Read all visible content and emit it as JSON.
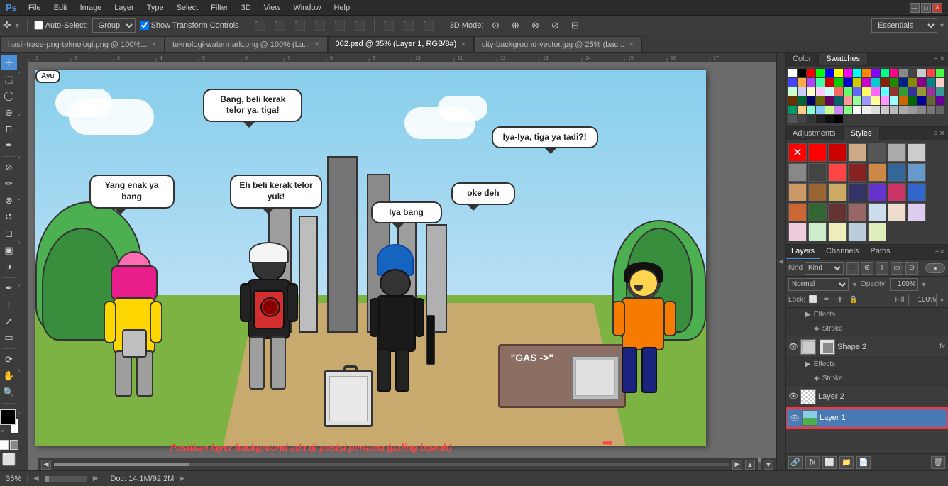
{
  "app": {
    "title": "Adobe Photoshop",
    "ps_icon": "Ps"
  },
  "menu": {
    "items": [
      "File",
      "Edit",
      "Image",
      "Layer",
      "Type",
      "Select",
      "Filter",
      "3D",
      "View",
      "Window",
      "Help"
    ]
  },
  "window_controls": {
    "minimize": "—",
    "maximize": "□",
    "close": "✕"
  },
  "options_bar": {
    "auto_select_label": "Auto-Select:",
    "group_value": "Group",
    "transform_label": "Show Transform Controls",
    "mode_label": "3D Mode:",
    "essentials_label": "Essentials",
    "essentials_arrow": "▼"
  },
  "tabs": [
    {
      "id": "tab1",
      "label": "hasil-trace-png-teknologi.png @ 100%...",
      "active": false,
      "modified": false
    },
    {
      "id": "tab2",
      "label": "teknologi-watermark.png @ 100% (La...",
      "active": false,
      "modified": false
    },
    {
      "id": "tab3",
      "label": "002.psd @ 35% (Layer 1, RGB/8#)",
      "active": true,
      "modified": true
    },
    {
      "id": "tab4",
      "label": "city-background-vector.jpg @ 25% (bac...",
      "active": false,
      "modified": false
    }
  ],
  "canvas": {
    "zoom": "35%",
    "doc_info": "Doc: 14.1M/92.2M"
  },
  "speech_bubbles": [
    {
      "id": "b1",
      "text": "Yang enak ya bang"
    },
    {
      "id": "b2",
      "text": "Bang, beli kerak telor ya, tiga!"
    },
    {
      "id": "b3",
      "text": "Eh beli kerak telor yuk!"
    },
    {
      "id": "b4",
      "text": "Iya bang"
    },
    {
      "id": "b5",
      "text": "oke deh"
    },
    {
      "id": "b6",
      "text": "Iya-Iya, tiga ya tadi?!"
    }
  ],
  "character_name": "Ayu",
  "instruction_text": "Pastikan layer background ada di posisi pertama (paling bawah)",
  "panels": {
    "color_tab": "Color",
    "swatches_tab": "Swatches",
    "adjustments_tab": "Adjustments",
    "styles_tab": "Styles",
    "layers_tab": "Layers",
    "channels_tab": "Channels",
    "paths_tab": "Paths"
  },
  "layers_panel": {
    "filter_label": "Kind",
    "blend_mode": "Normal",
    "opacity_label": "Opacity:",
    "opacity_value": "100%",
    "lock_label": "Lock:",
    "fill_label": "Fill:",
    "fill_value": "100%",
    "layers": [
      {
        "id": "effects1",
        "name": "Effects",
        "type": "sub",
        "visible": true
      },
      {
        "id": "stroke1",
        "name": "Stroke",
        "type": "sub-effect",
        "visible": true
      },
      {
        "id": "shape2",
        "name": "Shape 2",
        "type": "shape",
        "visible": true,
        "selected": false,
        "has_fx": true
      },
      {
        "id": "effects2",
        "name": "Effects",
        "type": "sub",
        "visible": true
      },
      {
        "id": "stroke2",
        "name": "Stroke",
        "type": "sub-effect",
        "visible": true
      },
      {
        "id": "layer2",
        "name": "Layer 2",
        "type": "normal",
        "visible": true,
        "selected": false
      },
      {
        "id": "layer1",
        "name": "Layer 1",
        "type": "normal",
        "visible": true,
        "selected": true
      }
    ],
    "bottom_buttons": [
      "link",
      "fx",
      "new-group",
      "new-layer",
      "delete"
    ]
  },
  "swatches": {
    "colors": [
      "#ffffff",
      "#000000",
      "#ff0000",
      "#00ff00",
      "#0000ff",
      "#ffff00",
      "#ff00ff",
      "#00ffff",
      "#ff8800",
      "#8800ff",
      "#00ff88",
      "#ff0088",
      "#888888",
      "#444444",
      "#cccccc",
      "#ff4444",
      "#44ff44",
      "#4444ff",
      "#ffaa44",
      "#aa44ff",
      "#44ffaa",
      "#cc0000",
      "#00cc00",
      "#0000cc",
      "#cccc00",
      "#cc00cc",
      "#00cccc",
      "#882200",
      "#228800",
      "#002288",
      "#888800",
      "#880088",
      "#008888",
      "#ffcccc",
      "#ccffcc",
      "#ccccff",
      "#ffffcc",
      "#ffccff",
      "#ccffff",
      "#ff6666",
      "#66ff66",
      "#6666ff",
      "#ffff66",
      "#ff66ff",
      "#66ffff",
      "#993333",
      "#339933",
      "#333399",
      "#999933",
      "#993399",
      "#339999",
      "#663300",
      "#006633",
      "#000066",
      "#666600",
      "#660066",
      "#006666",
      "#ff9999",
      "#99ff99",
      "#9999ff",
      "#ffff99",
      "#ff99ff",
      "#99ffff",
      "#cc6600",
      "#006600",
      "#000099",
      "#666633",
      "#660099",
      "#009966",
      "#ffcc88",
      "#88ffcc",
      "#88ccff",
      "#ccff88",
      "#cc88ff",
      "#88ff88",
      "#ffffff",
      "#eeeeee",
      "#dddddd",
      "#cccccc",
      "#bbbbbb",
      "#aaaaaa",
      "#999999",
      "#888888",
      "#777777",
      "#666666",
      "#555555",
      "#444444",
      "#333333",
      "#222222",
      "#111111",
      "#000000"
    ]
  },
  "styles_panel": {
    "swatches": [
      "#ff0000",
      "#cc0000",
      "#ccaa88",
      "#555555",
      "#aaaaaa",
      "#cccccc",
      "#888888",
      "#444444",
      "#ff4444",
      "#882222",
      "#cc8844",
      "#336699",
      "#6699cc",
      "#cc9966",
      "#996633",
      "#ccaa66",
      "#333366",
      "#6633cc",
      "#cc3366",
      "#3366cc",
      "#cc6633",
      "#336633",
      "#663333",
      "#996666",
      "#ccddee",
      "#eeddcc",
      "#ddccee",
      "#eeccdd",
      "#cceecc",
      "#eeeebb",
      "#bbccdd",
      "#ddeebb"
    ]
  },
  "tools": {
    "left": [
      {
        "name": "move",
        "icon": "✛",
        "active": true
      },
      {
        "name": "marquee",
        "icon": "⬚"
      },
      {
        "name": "lasso",
        "icon": "⊙"
      },
      {
        "name": "quick-select",
        "icon": "⊕"
      },
      {
        "name": "crop",
        "icon": "⊓"
      },
      {
        "name": "eyedropper",
        "icon": "✒"
      },
      {
        "name": "healing",
        "icon": "⊘"
      },
      {
        "name": "brush",
        "icon": "✏"
      },
      {
        "name": "clone-stamp",
        "icon": "⊗"
      },
      {
        "name": "history-brush",
        "icon": "↺"
      },
      {
        "name": "eraser",
        "icon": "◻"
      },
      {
        "name": "gradient",
        "icon": "▣"
      },
      {
        "name": "dodge",
        "icon": "◑"
      },
      {
        "name": "pen",
        "icon": "✒"
      },
      {
        "name": "text",
        "icon": "T"
      },
      {
        "name": "path-select",
        "icon": "↗"
      },
      {
        "name": "shape",
        "icon": "▭"
      },
      {
        "name": "3d-rotate",
        "icon": "⟳"
      },
      {
        "name": "hand",
        "icon": "✋"
      },
      {
        "name": "zoom",
        "icon": "🔍"
      }
    ]
  }
}
